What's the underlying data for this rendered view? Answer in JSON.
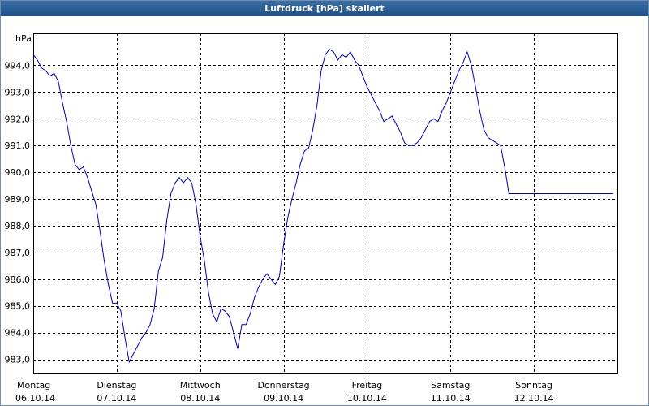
{
  "window": {
    "title": "Luftdruck [hPa] skaliert"
  },
  "chart_data": {
    "type": "line",
    "title": "Luftdruck [hPa] skaliert",
    "ylabel": "hPa",
    "ylim": [
      982.5,
      995.2
    ],
    "xlim": [
      0,
      7
    ],
    "yticks": [
      "983,0",
      "984,0",
      "985,0",
      "986,0",
      "987,0",
      "988,0",
      "989,0",
      "990,0",
      "991,0",
      "992,0",
      "993,0",
      "994,0"
    ],
    "ytick_values": [
      983,
      984,
      985,
      986,
      987,
      988,
      989,
      990,
      991,
      992,
      993,
      994
    ],
    "xticks": [
      {
        "day": "Montag",
        "date": "06.10.14",
        "x": 0
      },
      {
        "day": "Dienstag",
        "date": "07.10.14",
        "x": 1
      },
      {
        "day": "Mittwoch",
        "date": "08.10.14",
        "x": 2
      },
      {
        "day": "Donnerstag",
        "date": "09.10.14",
        "x": 3
      },
      {
        "day": "Freitag",
        "date": "10.10.14",
        "x": 4
      },
      {
        "day": "Samstag",
        "date": "11.10.14",
        "x": 5
      },
      {
        "day": "Sonntag",
        "date": "12.10.14",
        "x": 6
      }
    ],
    "grid": true,
    "line_color": "#0000aa",
    "series": [
      {
        "x": [
          0,
          0.05,
          0.1,
          0.15,
          0.2,
          0.25,
          0.3,
          0.35,
          0.4,
          0.45,
          0.5,
          0.55,
          0.6,
          0.65,
          0.7,
          0.75,
          0.8,
          0.85,
          0.9,
          0.95,
          1.0,
          1.05,
          1.1,
          1.15,
          1.2,
          1.25,
          1.3,
          1.35,
          1.4,
          1.45,
          1.5,
          1.55,
          1.6,
          1.65,
          1.7,
          1.75,
          1.8,
          1.85,
          1.9,
          1.95,
          2.0,
          2.05,
          2.1,
          2.15,
          2.2,
          2.25,
          2.3,
          2.35,
          2.4,
          2.45,
          2.5,
          2.55,
          2.6,
          2.65,
          2.7,
          2.75,
          2.8,
          2.85,
          2.9,
          2.95,
          3.0,
          3.05,
          3.1,
          3.15,
          3.2,
          3.25,
          3.3,
          3.35,
          3.4,
          3.45,
          3.5,
          3.55,
          3.6,
          3.65,
          3.7,
          3.75,
          3.8,
          3.85,
          3.9,
          3.95,
          4.0,
          4.05,
          4.1,
          4.15,
          4.2,
          4.25,
          4.3,
          4.35,
          4.4,
          4.45,
          4.5,
          4.55,
          4.6,
          4.65,
          4.7,
          4.75,
          4.8,
          4.85,
          4.9,
          4.95,
          5.0,
          5.05,
          5.1,
          5.15,
          5.2,
          5.25,
          5.3,
          5.35,
          5.4,
          5.45,
          5.5,
          5.55,
          5.6,
          5.65,
          5.7,
          5.75,
          5.8,
          5.85,
          5.9,
          5.95,
          6.0,
          6.05,
          6.1,
          6.15,
          6.2,
          6.25,
          6.3,
          6.35,
          6.4,
          6.45,
          6.5,
          6.55,
          6.6,
          6.65,
          6.7,
          6.75,
          6.8,
          6.85,
          6.9,
          6.95,
          7.0
        ],
        "y": [
          994.4,
          994.2,
          993.9,
          993.8,
          993.6,
          993.7,
          993.4,
          992.6,
          991.9,
          991.0,
          990.3,
          990.1,
          990.2,
          989.8,
          989.3,
          988.8,
          987.8,
          986.7,
          985.8,
          985.1,
          985.1,
          984.8,
          983.8,
          982.9,
          983.2,
          983.5,
          983.8,
          984.0,
          984.3,
          984.9,
          986.3,
          986.8,
          988.2,
          989.2,
          989.6,
          989.8,
          989.6,
          989.8,
          989.6,
          988.8,
          987.6,
          986.7,
          985.5,
          984.7,
          984.4,
          984.9,
          984.8,
          984.6,
          984.0,
          983.4,
          984.3,
          984.3,
          984.7,
          985.3,
          985.7,
          986.0,
          986.2,
          986.0,
          985.8,
          986.1,
          987.3,
          988.3,
          989.0,
          989.6,
          990.3,
          990.8,
          990.9,
          991.6,
          992.5,
          993.8,
          994.4,
          994.6,
          994.5,
          994.2,
          994.4,
          994.3,
          994.5,
          994.2,
          994.0,
          993.6,
          993.2,
          992.9,
          992.6,
          992.3,
          991.9,
          992.0,
          992.1,
          991.8,
          991.5,
          991.1,
          991.0,
          991.0,
          991.1,
          991.3,
          991.6,
          991.9,
          992.0,
          991.9,
          992.3,
          992.6,
          993.0,
          993.4,
          993.8,
          994.1,
          994.5,
          994.0,
          993.2,
          992.3,
          991.6,
          991.3,
          991.2,
          991.1,
          991.0,
          990.2,
          989.2,
          989.2,
          989.2,
          989.2,
          989.2,
          989.2,
          989.2,
          989.2,
          989.2,
          989.2,
          989.2,
          989.2,
          989.2,
          989.2,
          989.2,
          989.2,
          989.2,
          989.2,
          989.2,
          989.2,
          989.2,
          989.2,
          989.2,
          989.2,
          989.2,
          989.2,
          989.2
        ]
      }
    ]
  }
}
